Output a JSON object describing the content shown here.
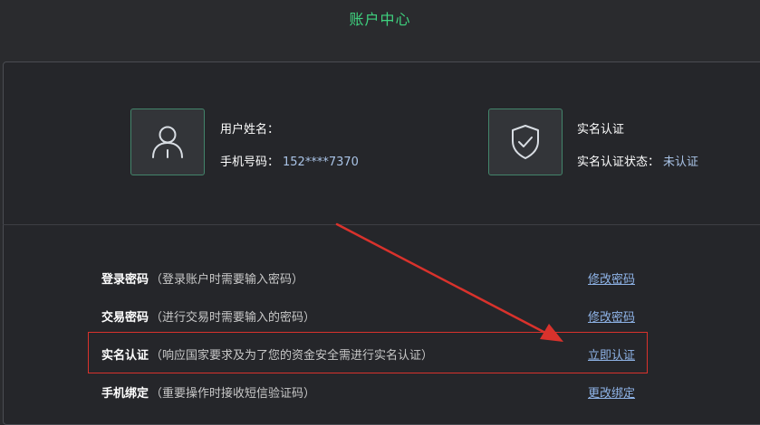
{
  "header": {
    "title": "账户中心"
  },
  "profile": {
    "icon": "user-icon",
    "username_label": "用户姓名：",
    "username_value": "",
    "phone_label": "手机号码：",
    "phone_value": "152****7370"
  },
  "verification": {
    "icon": "shield-check-icon",
    "title": "实名认证",
    "status_label": "实名认证状态：",
    "status_value": "未认证"
  },
  "security_items": [
    {
      "label": "登录密码",
      "description": "（登录账户时需要输入密码）",
      "action": "修改密码"
    },
    {
      "label": "交易密码",
      "description": "（进行交易时需要输入的密码）",
      "action": "修改密码"
    },
    {
      "label": "实名认证",
      "description": "（响应国家要求及为了您的资金安全需进行实名认证）",
      "action": "立即认证"
    },
    {
      "label": "手机绑定",
      "description": "（重要操作时接收短信验证码）",
      "action": "更改绑定"
    }
  ],
  "colors": {
    "accent_green": "#3fd27f",
    "link_blue": "#8fb4e8",
    "annotation_red": "#d9322c"
  }
}
